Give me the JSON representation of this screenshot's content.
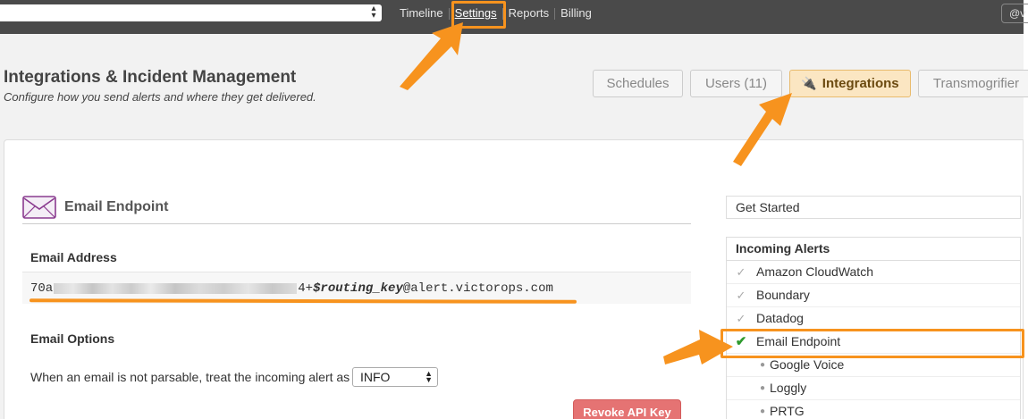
{
  "topbar": {
    "nav": [
      {
        "label": "Timeline",
        "active": false
      },
      {
        "label": "Settings",
        "active": true
      },
      {
        "label": "Reports",
        "active": false
      },
      {
        "label": "Billing",
        "active": false
      }
    ],
    "user_chip": "@v"
  },
  "header": {
    "title": "Integrations & Incident Management",
    "subtitle": "Configure how you send alerts and where they get delivered."
  },
  "tabs": [
    {
      "label": "Schedules",
      "active": false
    },
    {
      "label": "Users (11)",
      "active": false
    },
    {
      "label": "Integrations",
      "active": true
    },
    {
      "label": "Transmogrifier",
      "active": false
    }
  ],
  "email_endpoint": {
    "section_title": "Email Endpoint",
    "address_label": "Email Address",
    "address_prefix": "70a",
    "address_middle": "4+",
    "address_routing": "$routing_key",
    "address_domain": "@alert.victorops.com",
    "options_label": "Email Options",
    "parse_text": "When an email is not parsable, treat the incoming alert as",
    "parse_value": "INFO",
    "revoke_label": "Revoke API Key"
  },
  "sidebar": {
    "get_started": "Get Started",
    "incoming_title": "Incoming Alerts",
    "items": [
      {
        "label": "Amazon CloudWatch",
        "state": "check-faded"
      },
      {
        "label": "Boundary",
        "state": "check-faded"
      },
      {
        "label": "Datadog",
        "state": "check-faded"
      },
      {
        "label": "Email Endpoint",
        "state": "check-active"
      },
      {
        "label": "Google Voice",
        "state": "bullet"
      },
      {
        "label": "Loggly",
        "state": "bullet"
      },
      {
        "label": "PRTG",
        "state": "bullet"
      }
    ]
  },
  "colors": {
    "annotation": "#f7931e",
    "active_tab_bg": "#fbe6c2",
    "revoke_button": "#e57373",
    "check_active": "#2e9a2e"
  }
}
